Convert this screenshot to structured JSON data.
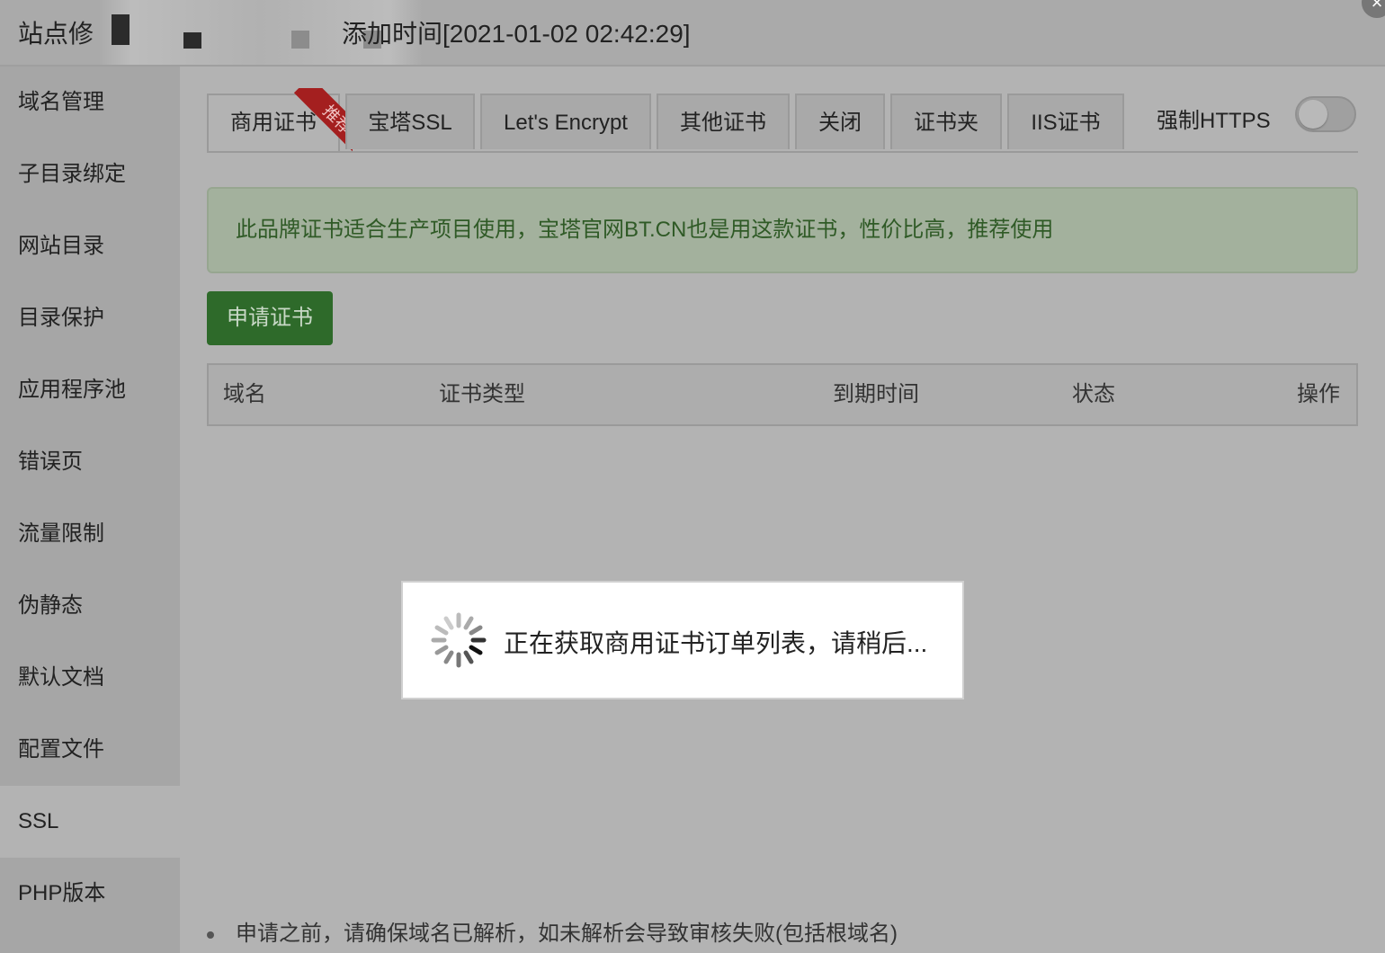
{
  "header": {
    "title_prefix": "站点修",
    "title_suffix": "添加时间[2021-01-02 02:42:29]",
    "close_icon": "close-icon"
  },
  "sidebar": {
    "items": [
      {
        "label": "域名管理"
      },
      {
        "label": "子目录绑定"
      },
      {
        "label": "网站目录"
      },
      {
        "label": "目录保护"
      },
      {
        "label": "应用程序池"
      },
      {
        "label": "错误页"
      },
      {
        "label": "流量限制"
      },
      {
        "label": "伪静态"
      },
      {
        "label": "默认文档"
      },
      {
        "label": "配置文件"
      },
      {
        "label": "SSL"
      },
      {
        "label": "PHP版本"
      }
    ],
    "active": "SSL"
  },
  "tabs": {
    "items": [
      {
        "label": "商用证书"
      },
      {
        "label": "宝塔SSL"
      },
      {
        "label": "Let's Encrypt"
      },
      {
        "label": "其他证书"
      },
      {
        "label": "关闭"
      },
      {
        "label": "证书夹"
      },
      {
        "label": "IIS证书"
      }
    ],
    "ribbon": "推荐",
    "active": "商用证书"
  },
  "force_https": {
    "label": "强制HTTPS",
    "enabled": false
  },
  "alert": {
    "text": "此品牌证书适合生产项目使用，宝塔官网BT.CN也是用这款证书，性价比高，推荐使用"
  },
  "apply_button": {
    "label": "申请证书"
  },
  "table": {
    "columns": [
      "域名",
      "证书类型",
      "到期时间",
      "状态",
      "操作"
    ],
    "rows": []
  },
  "note": {
    "text": "申请之前，请确保域名已解析，如未解析会导致审核失败(包括根域名)"
  },
  "loading": {
    "text": "正在获取商用证书订单列表，请稍后...",
    "icon": "spinner-icon"
  },
  "colors": {
    "apply_button": "#2e6a2a",
    "alert_text": "#2f5a26",
    "ribbon": "#a41f1f"
  }
}
